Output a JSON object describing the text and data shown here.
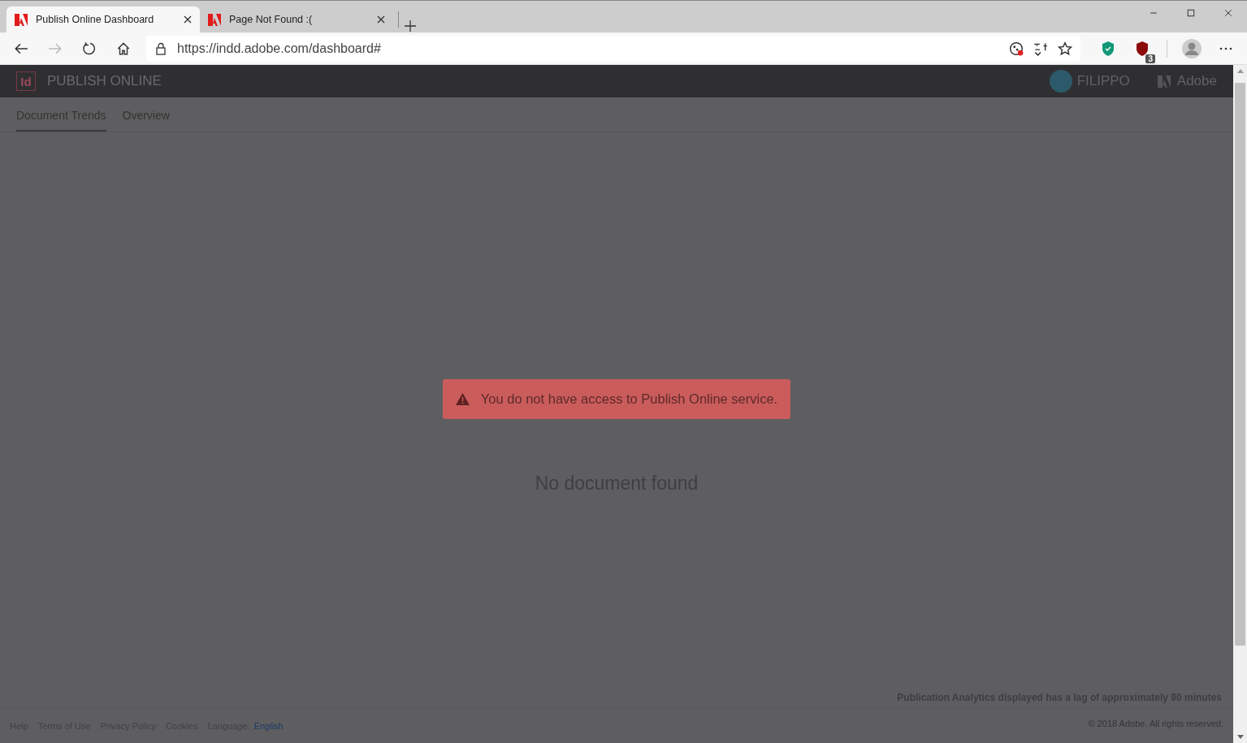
{
  "browser": {
    "tabs": [
      {
        "title": "Publish Online Dashboard",
        "selected": true
      },
      {
        "title": "Page Not Found :(",
        "selected": false
      }
    ],
    "address": {
      "url": "https://indd.adobe.com/dashboard#"
    },
    "extension_badge": "3"
  },
  "header": {
    "app_badge": "Id",
    "title": "PUBLISH ONLINE",
    "user": "FILIPPO",
    "vendor": "Adobe"
  },
  "nav": [
    {
      "label": "Document Trends",
      "selected": true
    },
    {
      "label": "Overview",
      "selected": false
    }
  ],
  "alert": {
    "message": "You do not have access to Publish Online service."
  },
  "empty_state": "No document found",
  "lag_note": "Publication Analytics displayed has a lag of approximately 90 minutes",
  "footer": {
    "links": [
      {
        "label": "Help",
        "kind": "link"
      },
      {
        "label": "Terms of Use",
        "kind": "link"
      },
      {
        "label": "Privacy Policy",
        "kind": "link"
      },
      {
        "label": "Cookies",
        "kind": "link"
      },
      {
        "label": "Language:",
        "kind": "label"
      },
      {
        "label": "English",
        "kind": "value"
      }
    ],
    "copyright": "© 2018 Adobe. All rights reserved."
  }
}
